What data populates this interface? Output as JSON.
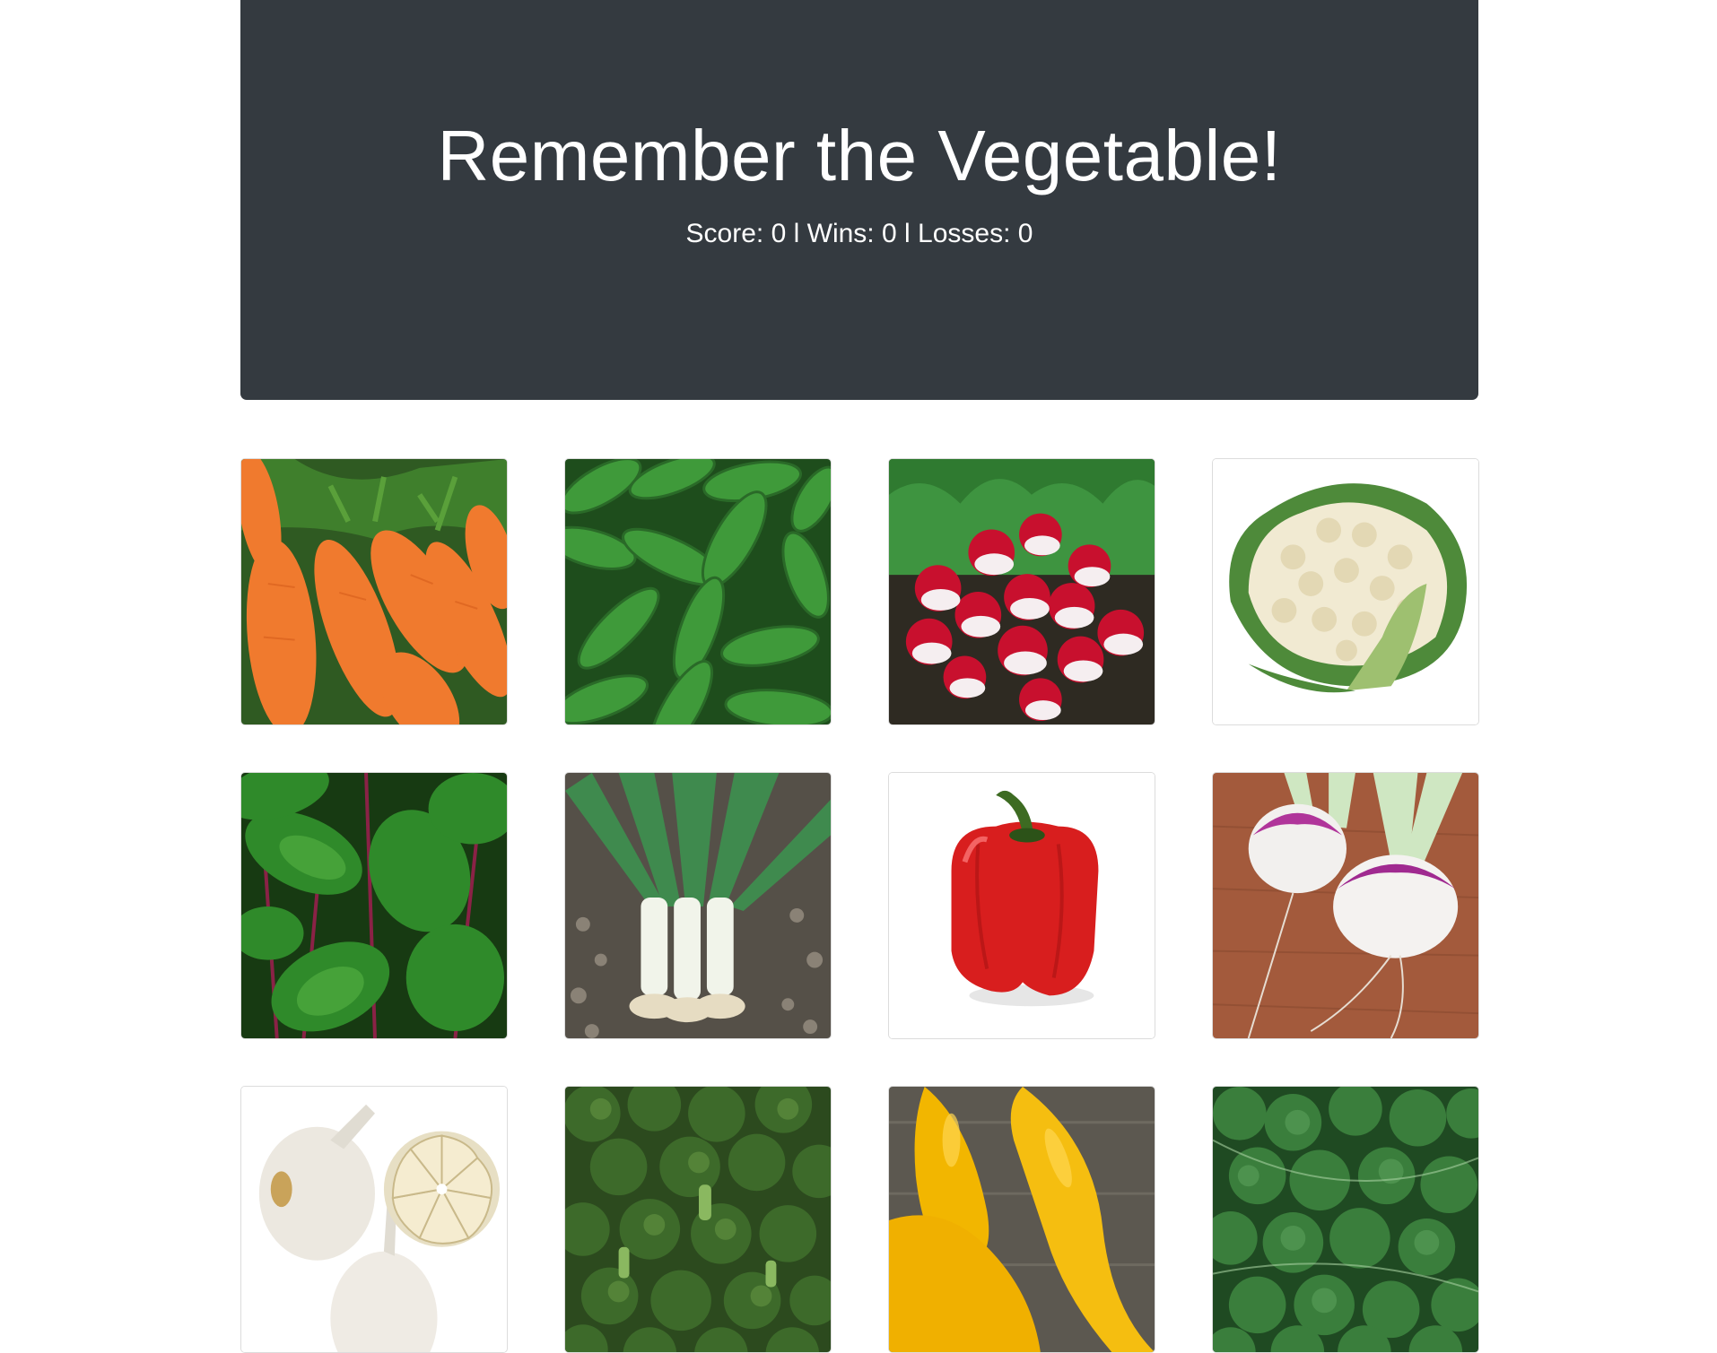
{
  "header": {
    "title": "Remember the Vegetable!",
    "score_label": "Score:",
    "score": "0",
    "wins_label": "Wins:",
    "wins": "0",
    "losses_label": "Losses:",
    "losses": "0",
    "separator": "l"
  },
  "cards": [
    {
      "name": "carrots"
    },
    {
      "name": "cucumbers"
    },
    {
      "name": "radishes"
    },
    {
      "name": "cauliflower"
    },
    {
      "name": "spinach"
    },
    {
      "name": "leeks"
    },
    {
      "name": "red-bell-pepper"
    },
    {
      "name": "turnips"
    },
    {
      "name": "garlic"
    },
    {
      "name": "broccoli"
    },
    {
      "name": "yellow-squash"
    },
    {
      "name": "kale"
    }
  ],
  "colors": {
    "header_bg": "#343a40",
    "header_text": "#ffffff",
    "page_bg": "#ffffff"
  }
}
